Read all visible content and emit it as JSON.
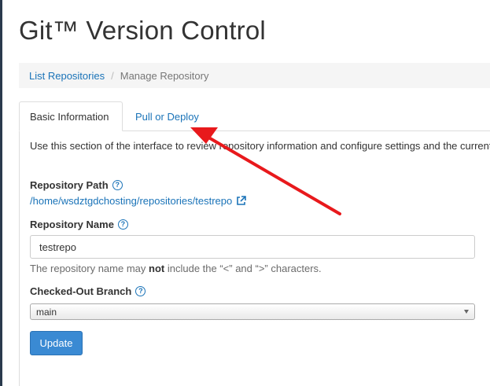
{
  "page": {
    "title": "Git™ Version Control"
  },
  "breadcrumb": {
    "items": [
      {
        "label": "List Repositories"
      },
      {
        "label": "Manage Repository"
      }
    ],
    "separator": "/"
  },
  "tabs": [
    {
      "label": "Basic Information",
      "active": true
    },
    {
      "label": "Pull or Deploy",
      "active": false
    }
  ],
  "main": {
    "intro": "Use this section of the interface to review repository information and configure settings and the current branch.",
    "repository_path": {
      "label": "Repository Path",
      "value": "/home/wsdztgdchosting/repositories/testrepo",
      "help_icon": "question-circle-icon",
      "link_icon": "external-link-icon"
    },
    "repository_name": {
      "label": "Repository Name",
      "value": "testrepo",
      "help_icon": "question-circle-icon",
      "help_prefix": "The repository name may ",
      "help_emphasis": "not",
      "help_suffix": " include the “<” and “>” characters."
    },
    "branch": {
      "label": "Checked-Out Branch",
      "selected": "main",
      "help_icon": "question-circle-icon"
    },
    "update_label": "Update"
  },
  "annotation": {
    "type": "arrow",
    "color": "#e8191c",
    "points_to": "tab-pull-or-deploy"
  },
  "colors": {
    "link": "#1a73b8",
    "primary_button": "#3a8ad3",
    "breadcrumb_bg": "#f5f5f5"
  }
}
